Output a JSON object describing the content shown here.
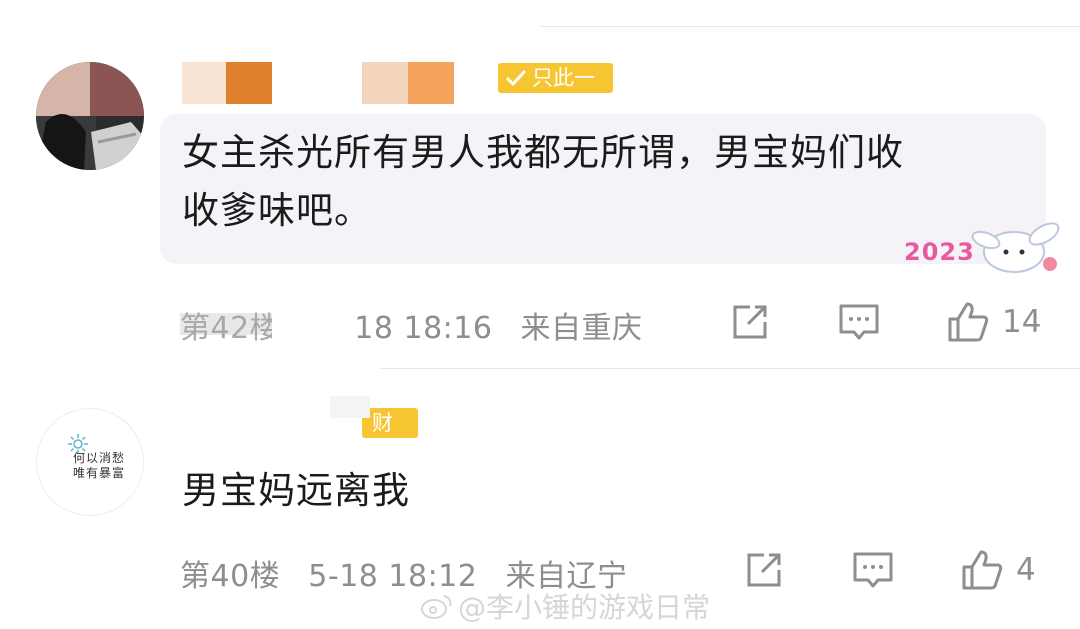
{
  "comments": [
    {
      "badge": "只此一人",
      "text_line1": "女主杀光所有男人我都无所谓，男宝妈们收",
      "text_line2": "收爹味吧。",
      "sticker_year": "2023",
      "floor": "第42楼",
      "date_time": "18 18:16",
      "location": "来自重庆",
      "likes": "14"
    },
    {
      "badge": "财迷",
      "avatar_text_line1": "何以消愁",
      "avatar_text_line2": "唯有暴富",
      "text": "男宝妈远离我",
      "floor": "第40楼",
      "date_time": "5-18 18:12",
      "location": "来自辽宁",
      "likes": "4"
    }
  ],
  "watermark": "@李小锤的游戏日常",
  "icons": [
    "share-icon",
    "comment-icon",
    "like-icon",
    "verified-icon",
    "weibo-icon"
  ],
  "colors": {
    "badge": "#f7c531",
    "meta_text": "#8e8e8e",
    "bubble": "#f6f3f8"
  }
}
